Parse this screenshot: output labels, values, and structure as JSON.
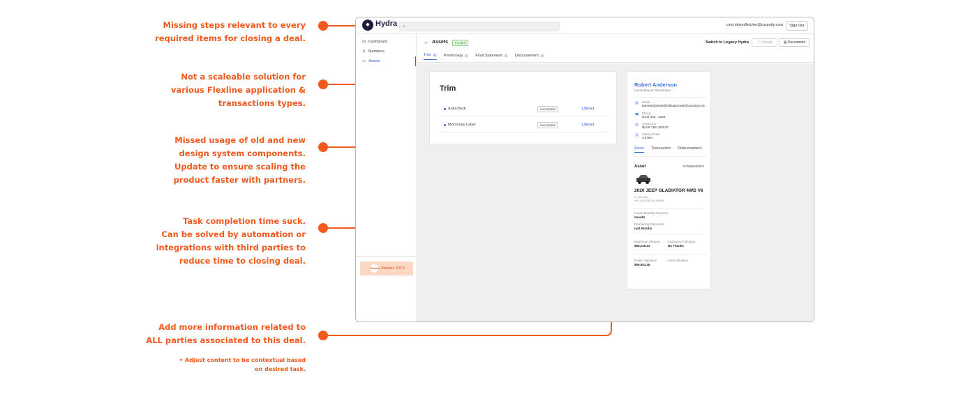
{
  "annotations": [
    {
      "lines": [
        "Missing steps relevant to every",
        "required items for closing a deal."
      ]
    },
    {
      "lines": [
        "Not a scaleable solution for",
        "various Flexline application &",
        "transactions types."
      ]
    },
    {
      "lines": [
        "Missed usage of old and new",
        "design system components.",
        "Update to ensure scaling the",
        "product faster with partners."
      ]
    },
    {
      "lines": [
        "Task completion time suck.",
        "Can be solved by automation or",
        "integrations with third parties to",
        "reduce time to closing deal."
      ]
    },
    {
      "lines": [
        "Add more information related to",
        "ALL parties associated to this deal."
      ]
    }
  ],
  "annotation_note": [
    "• Adjust content to be contextual based",
    "on desired task."
  ],
  "accent_color": "#f05a1e",
  "app": {
    "name": "Hydra",
    "user_email": "cmd.mlsonfletcher@carputty.com",
    "sign_out": "Sign Out"
  },
  "sidebar": {
    "items": [
      {
        "label": "Dashboard",
        "icon": "clock-icon"
      },
      {
        "label": "Members",
        "icon": "person-icon"
      },
      {
        "label": "Assets",
        "icon": "car-icon"
      }
    ],
    "version": "Version: 2.0.0",
    "version_badge": "Flexline"
  },
  "header": {
    "title": "Assets",
    "status": "Funded",
    "legacy_link": "Switch to Legacy Hydra",
    "upload_button": "Upload",
    "documents_button": "Documents",
    "tabs": [
      {
        "label": "Trim",
        "count": "2"
      },
      {
        "label": "Preliminary",
        "count": "1"
      },
      {
        "label": "Final Statement",
        "count": "1"
      },
      {
        "label": "Disbursement",
        "count": "4"
      }
    ]
  },
  "trim": {
    "title": "Trim",
    "rows": [
      {
        "label": "Autocheck",
        "status": "Incomplete",
        "action": "Upload"
      },
      {
        "label": "Monroney Label",
        "status": "Incomplete",
        "action": "Upload"
      }
    ]
  },
  "party": {
    "name": "Robert Anderson",
    "subtitle": "Lease Buyout Transaction",
    "email_label": "Email",
    "email": "barnettrobert28@billsapproval@carputty.com",
    "phone_label": "Phone",
    "phone": "(123) 333 - 3333",
    "credit_label": "Used Line",
    "credit": "$0.00 / $51,000.00",
    "rate_label": "Interest Rate",
    "rate": "4.579%",
    "tabs": [
      "Asset",
      "Transaction",
      "Disbursement"
    ],
    "asset_heading": "Asset",
    "asset_id": "#V0086260570",
    "car_name": "2020 JEEP GLADIATOR 4WD V6",
    "car_miles": "21,000 miles",
    "car_vin": "VIN: 1C6JJTEG6LL000545",
    "monthly_label": "Lease Monthly Payment",
    "monthly_value": "/month",
    "remaining_label": "Remaining Payments",
    "remaining_value": "null Months",
    "max_label": "Maximum Allowed",
    "max_value": "$58,235.22",
    "insurance_label": "Insurance Followup",
    "insurance_value": "No Thanks",
    "prelim_label": "Prelim Valuation",
    "prelim_value": "$56,803.46",
    "final_label": "Final Valuation",
    "final_value": ""
  }
}
